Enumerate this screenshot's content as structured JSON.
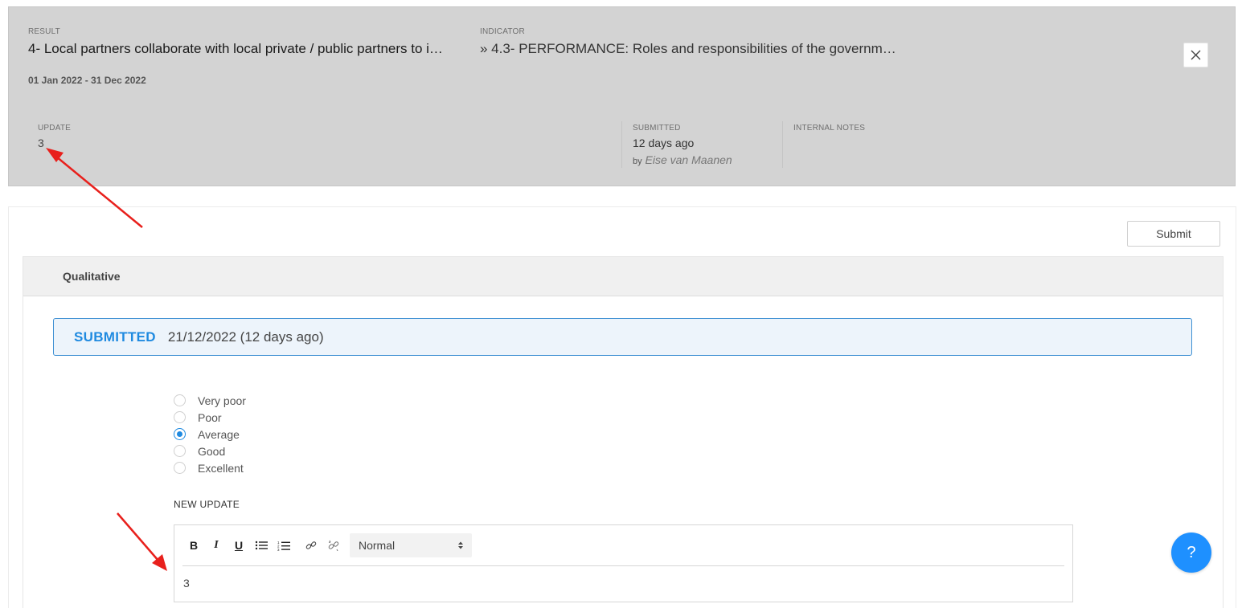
{
  "header": {
    "result_caption": "RESULT",
    "result_title": "4- Local partners collaborate with local private / public partners to i…",
    "indicator_caption": "INDICATOR",
    "indicator_title": "» 4.3- PERFORMANCE: Roles and responsibilities of the governm…",
    "period": "01 Jan 2022 - 31 Dec 2022",
    "close_icon": "close-icon"
  },
  "meta": {
    "update_caption": "UPDATE",
    "update_value": "3",
    "submitted_caption": "SUBMITTED",
    "submitted_value": "12 days ago",
    "by_label": "by",
    "by_name": "Eise van Maanen",
    "notes_caption": "INTERNAL NOTES"
  },
  "main": {
    "submit_label": "Submit",
    "section_title": "Qualitative",
    "status_label": "SUBMITTED",
    "status_date": "21/12/2022 (12 days ago)",
    "radio_options": [
      {
        "label": "Very poor",
        "checked": false
      },
      {
        "label": "Poor",
        "checked": false
      },
      {
        "label": "Average",
        "checked": true
      },
      {
        "label": "Good",
        "checked": false
      },
      {
        "label": "Excellent",
        "checked": false
      }
    ],
    "new_update_label": "NEW UPDATE",
    "editor": {
      "tools": [
        "bold-icon",
        "italic-icon",
        "underline-icon",
        "bullet-list-icon",
        "ordered-list-icon",
        "link-icon",
        "unlink-icon"
      ],
      "format_select": "Normal",
      "content": "3"
    }
  },
  "help": {
    "label": "?"
  },
  "colors": {
    "accent": "#1f8ae0",
    "header_bg": "#d3d3d3",
    "annotation_arrow": "#e8201c"
  }
}
